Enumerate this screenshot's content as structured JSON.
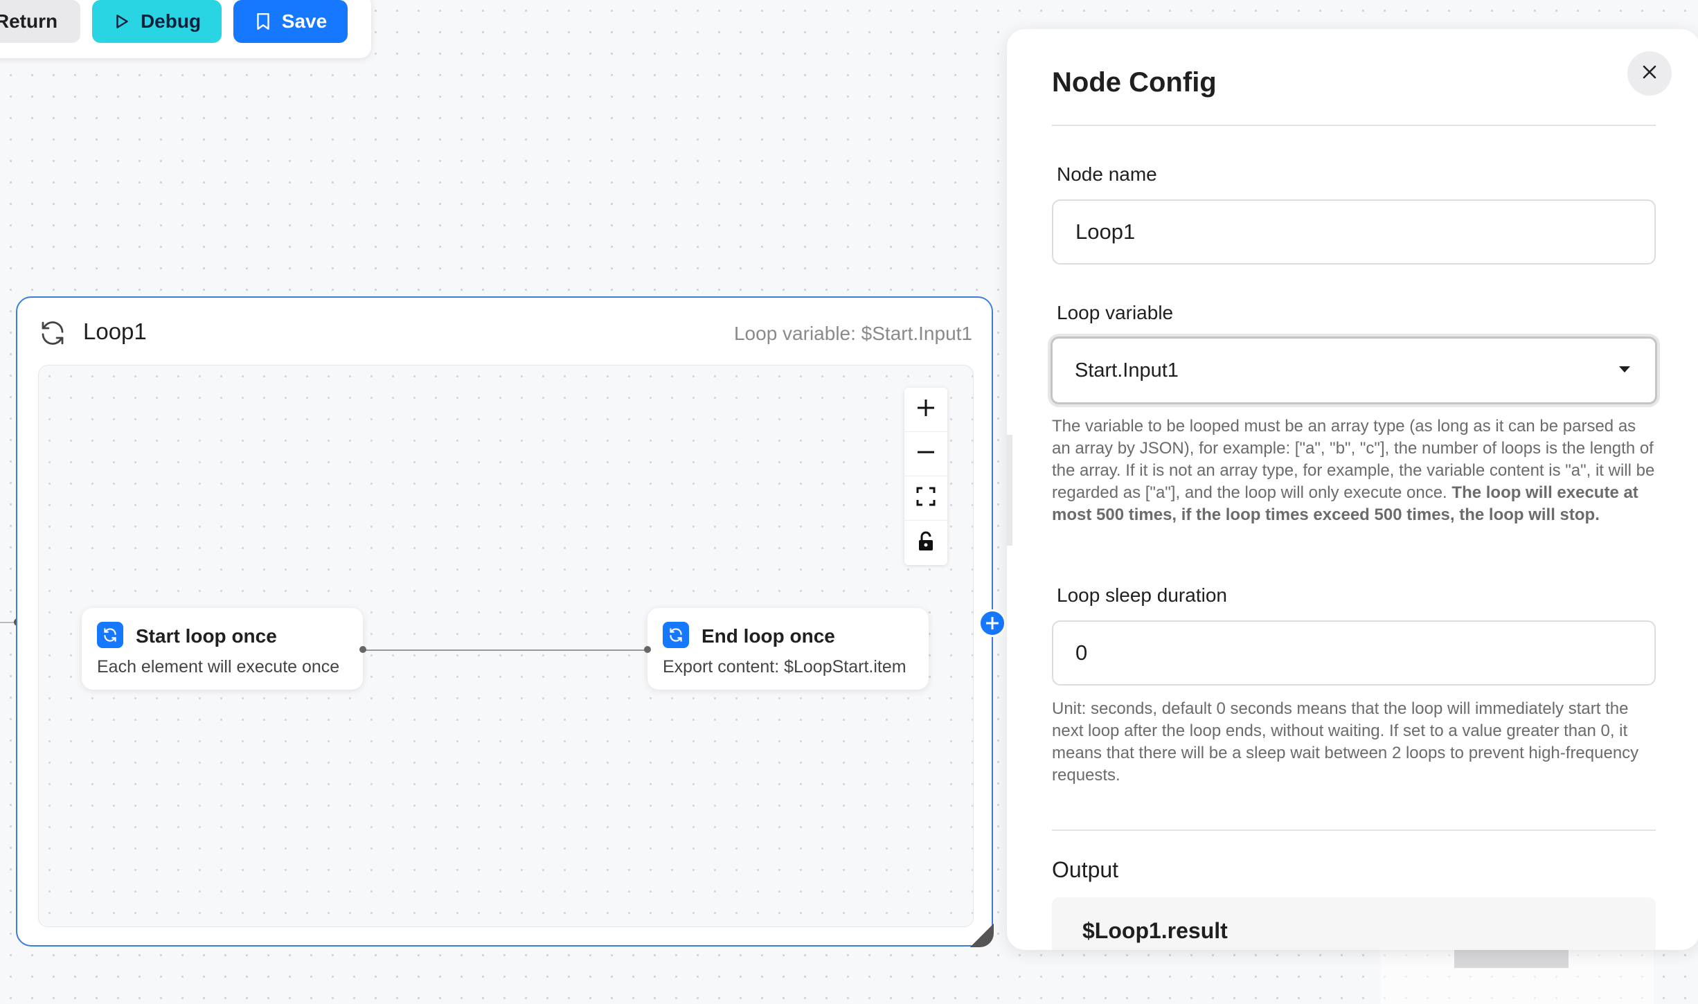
{
  "toolbar": {
    "return_label": "Return",
    "debug_label": "Debug",
    "save_label": "Save"
  },
  "loop_group": {
    "title": "Loop1",
    "variable_hint": "Loop variable: $Start.Input1"
  },
  "zoom_controls": [
    "zoom-in",
    "zoom-out",
    "fit-view",
    "lock"
  ],
  "nodes": {
    "start": {
      "title": "Start loop once",
      "description": "Each element will execute once"
    },
    "end": {
      "title": "End loop once",
      "description": "Export content: $LoopStart.item"
    }
  },
  "panel": {
    "title": "Node Config",
    "node_name": {
      "label": "Node name",
      "value": "Loop1"
    },
    "loop_variable": {
      "label": "Loop variable",
      "value": "Start.Input1",
      "help_normal": "The variable to be looped must be an array type (as long as it can be parsed as an array by JSON), for example: [\"a\", \"b\", \"c\"], the number of loops is the length of the array. If it is not an array type, for example, the variable content is \"a\", it will be regarded as [\"a\"], and the loop will only execute once. ",
      "help_bold": "The loop will execute at most 500 times, if the loop times exceed 500 times, the loop will stop."
    },
    "loop_sleep": {
      "label": "Loop sleep duration",
      "value": "0",
      "help": "Unit: seconds, default 0 seconds means that the loop will immediately start the next loop after the loop ends, without waiting. If set to a value greater than 0, it means that there will be a sleep wait between 2 loops to prevent high-frequency requests."
    },
    "output": {
      "title": "Output",
      "variable": "$Loop1.result"
    }
  },
  "colors": {
    "primary": "#1677ff",
    "debug": "#2ad5e3",
    "group_border": "#3b7ddd"
  }
}
